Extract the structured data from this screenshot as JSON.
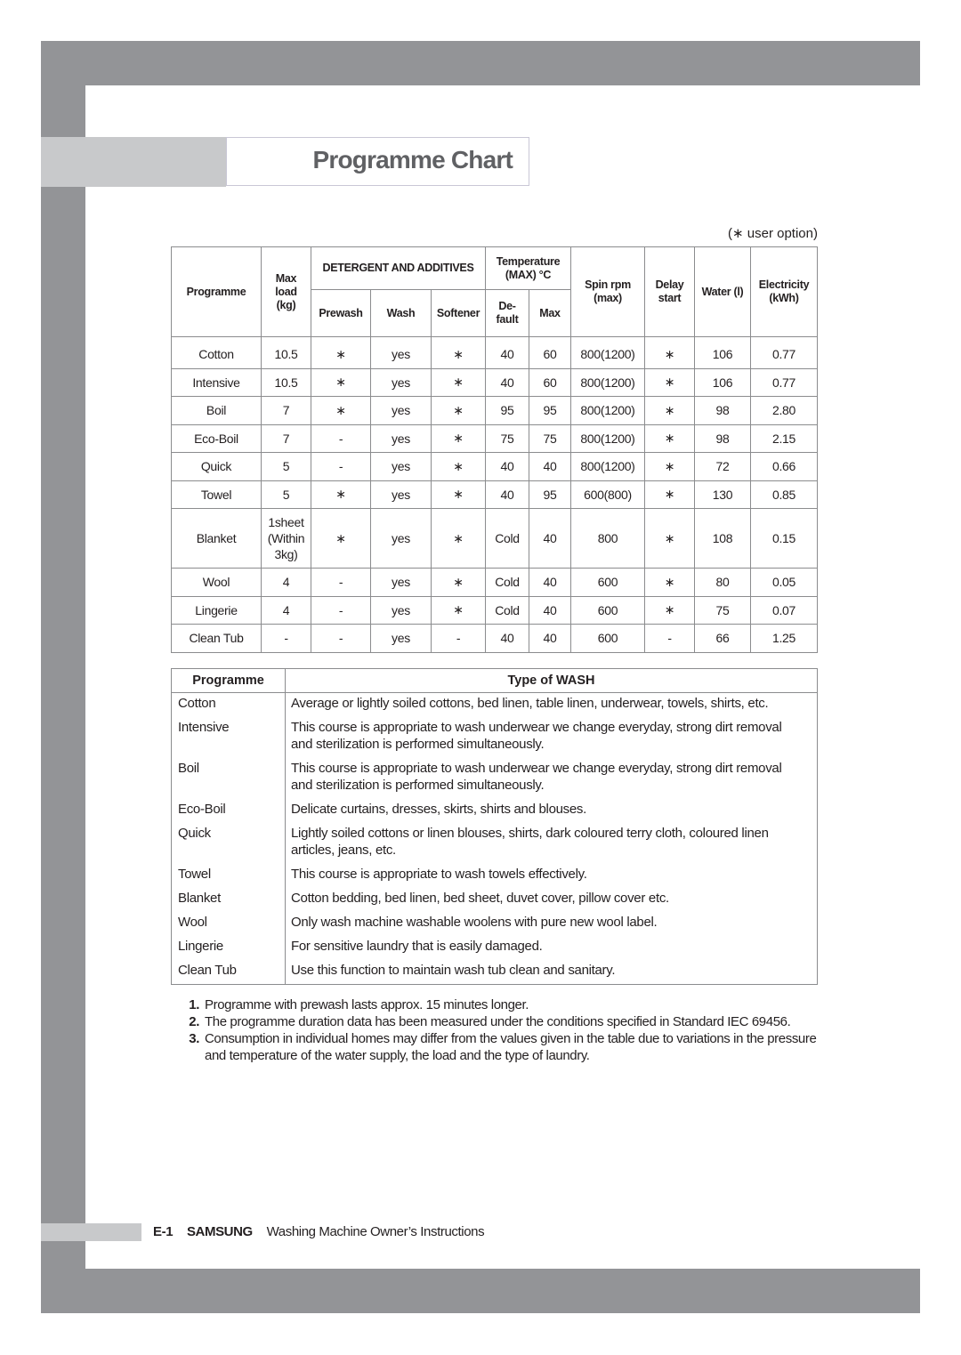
{
  "page": {
    "title": "Programme Chart",
    "user_option_note": "(∗ user option)",
    "footer": {
      "page_number": "E-1",
      "brand": "SAMSUNG",
      "document": "Washing Machine Owner’s Instructions"
    },
    "colors": {
      "frame": "#939497",
      "band": "#c8c9cb",
      "title_text": "#606164"
    }
  },
  "programme_table": {
    "headers": {
      "programme": "Programme",
      "max_load": "Max load (kg)",
      "detergent_group": "DETERGENT AND ADDITIVES",
      "prewash": "Prewash",
      "wash": "Wash",
      "softener": "Softener",
      "temperature_group": "Temperature (MAX) °C",
      "temp_default": "De-fault",
      "temp_max": "Max",
      "spin": "Spin rpm (max)",
      "delay": "Delay start",
      "water": "Water (l)",
      "electricity": "Electricity (kWh)"
    },
    "rows": [
      {
        "programme": "Cotton",
        "load": "10.5",
        "prewash": "∗",
        "wash": "yes",
        "softener": "∗",
        "temp_default": "40",
        "temp_max": "60",
        "spin": "800(1200)",
        "delay": "∗",
        "water": "106",
        "electricity": "0.77"
      },
      {
        "programme": "Intensive",
        "load": "10.5",
        "prewash": "∗",
        "wash": "yes",
        "softener": "∗",
        "temp_default": "40",
        "temp_max": "60",
        "spin": "800(1200)",
        "delay": "∗",
        "water": "106",
        "electricity": "0.77"
      },
      {
        "programme": "Boil",
        "load": "7",
        "prewash": "∗",
        "wash": "yes",
        "softener": "∗",
        "temp_default": "95",
        "temp_max": "95",
        "spin": "800(1200)",
        "delay": "∗",
        "water": "98",
        "electricity": "2.80"
      },
      {
        "programme": "Eco-Boil",
        "load": "7",
        "prewash": "-",
        "wash": "yes",
        "softener": "∗",
        "temp_default": "75",
        "temp_max": "75",
        "spin": "800(1200)",
        "delay": "∗",
        "water": "98",
        "electricity": "2.15"
      },
      {
        "programme": "Quick",
        "load": "5",
        "prewash": "-",
        "wash": "yes",
        "softener": "∗",
        "temp_default": "40",
        "temp_max": "40",
        "spin": "800(1200)",
        "delay": "∗",
        "water": "72",
        "electricity": "0.66"
      },
      {
        "programme": "Towel",
        "load": "5",
        "prewash": "∗",
        "wash": "yes",
        "softener": "∗",
        "temp_default": "40",
        "temp_max": "95",
        "spin": "600(800)",
        "delay": "∗",
        "water": "130",
        "electricity": "0.85"
      },
      {
        "programme": "Blanket",
        "load": "1sheet (Within 3kg)",
        "prewash": "∗",
        "wash": "yes",
        "softener": "∗",
        "temp_default": "Cold",
        "temp_max": "40",
        "spin": "800",
        "delay": "∗",
        "water": "108",
        "electricity": "0.15"
      },
      {
        "programme": "Wool",
        "load": "4",
        "prewash": "-",
        "wash": "yes",
        "softener": "∗",
        "temp_default": "Cold",
        "temp_max": "40",
        "spin": "600",
        "delay": "∗",
        "water": "80",
        "electricity": "0.05"
      },
      {
        "programme": "Lingerie",
        "load": "4",
        "prewash": "-",
        "wash": "yes",
        "softener": "∗",
        "temp_default": "Cold",
        "temp_max": "40",
        "spin": "600",
        "delay": "∗",
        "water": "75",
        "electricity": "0.07"
      },
      {
        "programme": "Clean Tub",
        "load": "-",
        "prewash": "-",
        "wash": "yes",
        "softener": "-",
        "temp_default": "40",
        "temp_max": "40",
        "spin": "600",
        "delay": "-",
        "water": "66",
        "electricity": "1.25"
      }
    ]
  },
  "wash_table": {
    "headers": {
      "programme": "Programme",
      "type": "Type of WASH"
    },
    "rows": [
      {
        "programme": "Cotton",
        "description": "Average or lightly soiled cottons, bed linen, table linen, underwear, towels, shirts, etc."
      },
      {
        "programme": "Intensive",
        "description": "This course is appropriate to wash underwear we change everyday, strong dirt removal and sterilization is performed simultaneously."
      },
      {
        "programme": "Boil",
        "description": "This course is appropriate to wash underwear we change everyday, strong dirt removal and sterilization is performed simultaneously."
      },
      {
        "programme": "Eco-Boil",
        "description": "Delicate curtains, dresses, skirts, shirts and blouses."
      },
      {
        "programme": "Quick",
        "description": "Lightly soiled cottons or linen blouses, shirts, dark coloured terry cloth, coloured linen articles, jeans, etc."
      },
      {
        "programme": "Towel",
        "description": "This course is appropriate to wash towels effectively."
      },
      {
        "programme": "Blanket",
        "description": "Cotton bedding, bed linen, bed sheet, duvet cover, pillow cover etc."
      },
      {
        "programme": "Wool",
        "description": "Only wash machine washable woolens with pure new wool label."
      },
      {
        "programme": "Lingerie",
        "description": "For sensitive laundry that is easily damaged."
      },
      {
        "programme": "Clean Tub",
        "description": "Use this function to maintain wash tub clean and sanitary."
      }
    ]
  },
  "notes": [
    {
      "number": "1.",
      "text": "Programme with prewash lasts approx. 15 minutes longer."
    },
    {
      "number": "2.",
      "text": "The programme duration data has been measured under the conditions specified in Standard IEC 69456."
    },
    {
      "number": "3.",
      "text": "Consumption in individual homes may differ from the values given in the table due to variations in the pressure and temperature of the water supply, the load and the type of laundry."
    }
  ]
}
